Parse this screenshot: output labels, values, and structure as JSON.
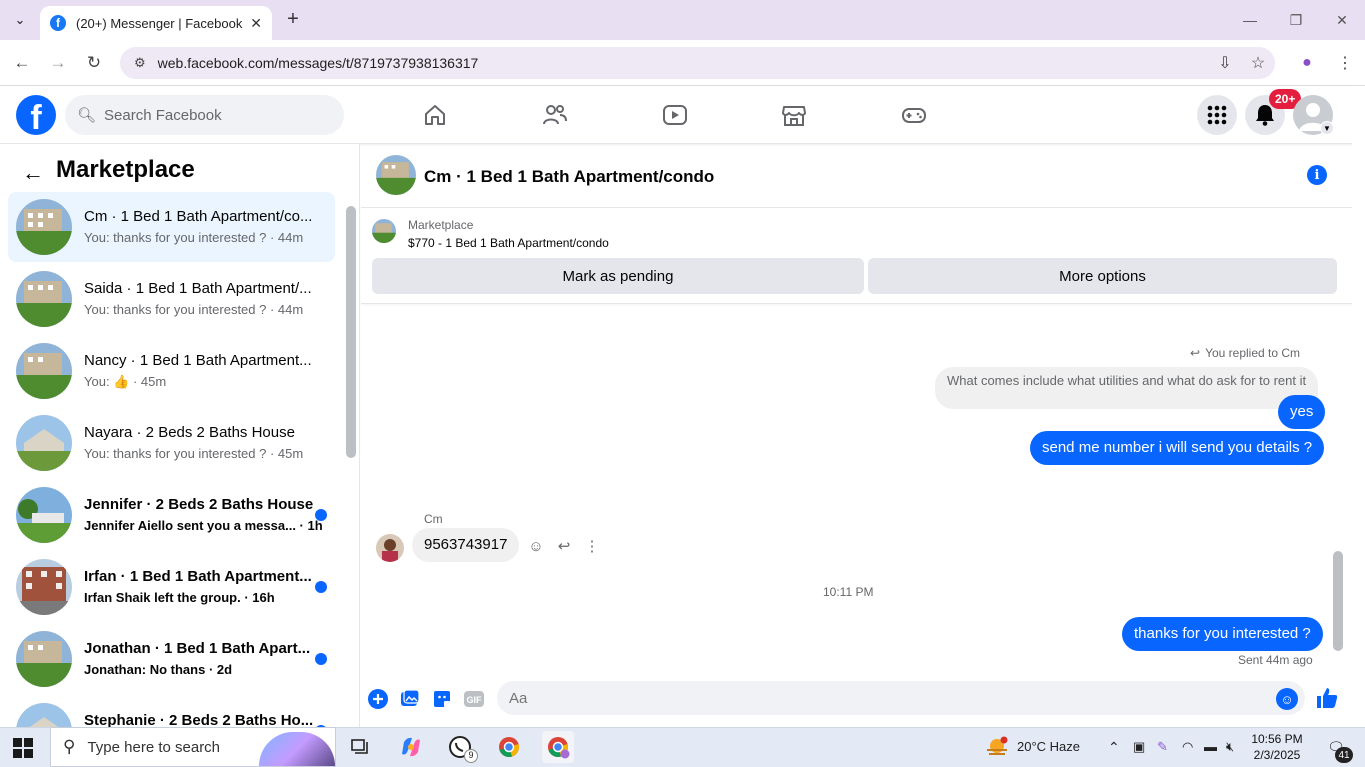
{
  "browser": {
    "tab_title": "(20+) Messenger | Facebook",
    "url": "web.facebook.com/messages/t/8719737938136317"
  },
  "fb": {
    "search_placeholder": "Search Facebook",
    "notif_badge": "20+",
    "brand_color": "#0866ff"
  },
  "sidebar": {
    "title": "Marketplace",
    "conversations": [
      {
        "name": "Cm · 1 Bed 1 Bath Apartment/co...",
        "preview": "You: thanks for you interested ? · 44m",
        "selected": true,
        "unread": false
      },
      {
        "name": "Saida · 1 Bed 1 Bath Apartment/...",
        "preview": "You: thanks for you interested ? · 44m",
        "selected": false,
        "unread": false
      },
      {
        "name": "Nancy · 1 Bed 1 Bath Apartment...",
        "preview": "You: 👍 · 45m",
        "selected": false,
        "unread": false
      },
      {
        "name": "Nayara · 2 Beds 2 Baths House",
        "preview": "You: thanks for you interested ? · 45m",
        "selected": false,
        "unread": false
      },
      {
        "name": "Jennifer · 2 Beds 2 Baths House",
        "preview": "Jennifer Aiello sent you a messa... · 1h",
        "selected": false,
        "unread": true
      },
      {
        "name": "Irfan · 1 Bed 1 Bath Apartment...",
        "preview": "Irfan Shaik left the group. · 16h",
        "selected": false,
        "unread": true
      },
      {
        "name": "Jonathan · 1 Bed 1 Bath Apart...",
        "preview": "Jonathan: No thans · 2d",
        "selected": false,
        "unread": true
      },
      {
        "name": "Stephanie · 2 Beds 2 Baths Ho...",
        "preview": "",
        "selected": false,
        "unread": true
      }
    ]
  },
  "chat": {
    "title": "Cm · 1 Bed 1 Bath Apartment/condo",
    "listing_label": "Marketplace",
    "listing_price": "$770 - 1 Bed 1 Bath Apartment/condo",
    "btn_pending": "Mark as pending",
    "btn_more": "More options",
    "reply_hint": "You replied to Cm",
    "quoted": "What comes include what utilities and what do ask for to rent it",
    "msg_yes": "yes",
    "msg_send": "send me number i will send you details ?",
    "sender": "Cm",
    "incoming": "9563743917",
    "time": "10:11 PM",
    "msg_thanks": "thanks for you interested ?",
    "sent_status": "Sent 44m ago",
    "composer_placeholder": "Aa",
    "gif_label": "GIF"
  },
  "taskbar": {
    "search": "Type here to search",
    "weather": "20°C  Haze",
    "time": "10:56 PM",
    "date": "2/3/2025",
    "whatsapp_badge": "9",
    "notif_count": "41"
  }
}
